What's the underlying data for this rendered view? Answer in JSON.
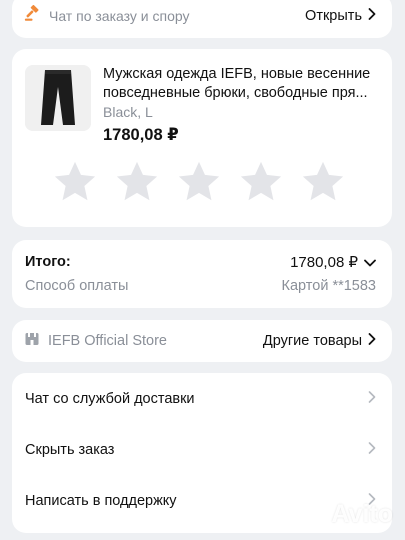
{
  "support": {
    "text": "Чат по заказу и спору",
    "action": "Открыть",
    "icon": "gavel-icon"
  },
  "product": {
    "title_line1": "Мужская одежда IEFB, новые весенние",
    "title_line2": "повседневные брюки, свободные пря...",
    "variant": "Black, L",
    "price": "1780,08 ₽",
    "rating_stars": 5,
    "rating_selected": 0
  },
  "total": {
    "label": "Итого:",
    "amount": "1780,08 ₽",
    "payment_label": "Способ оплаты",
    "payment_value": "Картой **1583"
  },
  "store": {
    "name": "IEFB Official Store",
    "action": "Другие товары"
  },
  "actions": [
    {
      "label": "Чат со службой доставки"
    },
    {
      "label": "Скрыть заказ"
    },
    {
      "label": "Написать в поддержку"
    }
  ],
  "watermark": {
    "text": "Avito"
  },
  "colors": {
    "background": "#eef0f3",
    "card": "#ffffff",
    "accent_orange": "#f08a3a",
    "muted_text": "#8a8f98",
    "star_empty": "#e3e4e8"
  }
}
